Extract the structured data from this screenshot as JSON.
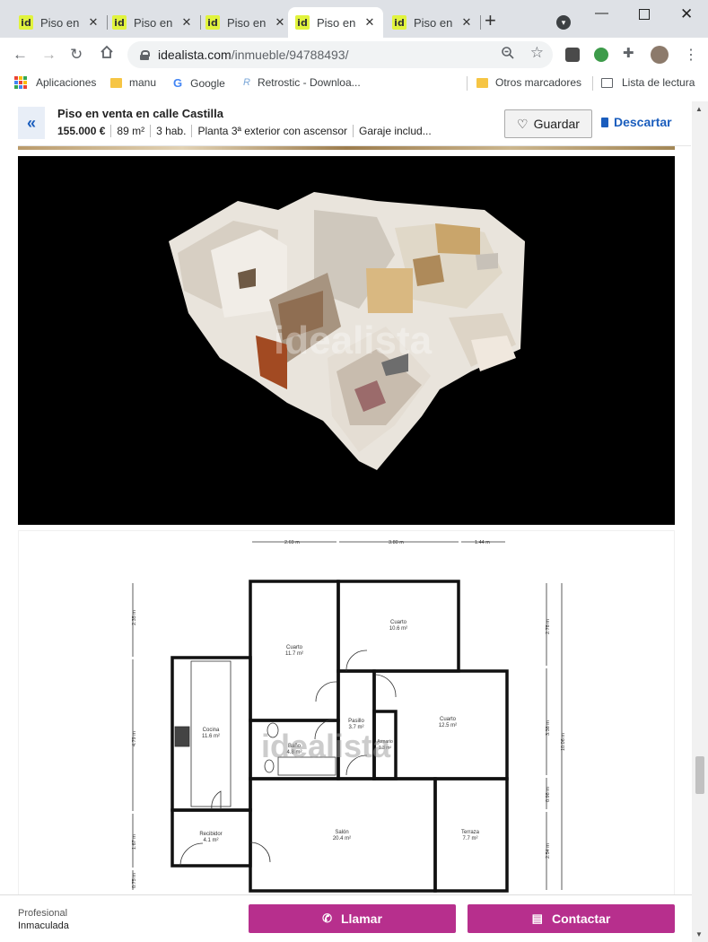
{
  "browser": {
    "tabs": [
      {
        "title": "Piso en",
        "favicon": "id",
        "active": false
      },
      {
        "title": "Piso en",
        "favicon": "id",
        "active": false
      },
      {
        "title": "Piso en",
        "favicon": "id",
        "active": false
      },
      {
        "title": "Piso en",
        "favicon": "id",
        "active": true
      },
      {
        "title": "Piso en",
        "favicon": "id",
        "active": false
      }
    ],
    "url_host": "idealista.com",
    "url_path": "/inmueble/94788493/",
    "bookmarks": [
      {
        "label": "Aplicaciones",
        "icon": "apps-icon"
      },
      {
        "label": "manu",
        "icon": "folder-icon"
      },
      {
        "label": "Google",
        "icon": "google-icon"
      },
      {
        "label": "Retrostic - Downloa...",
        "icon": "retrostic-icon"
      },
      {
        "label": "Otros marcadores",
        "icon": "folder-icon"
      },
      {
        "label": "Lista de lectura",
        "icon": "reading-list-icon"
      }
    ]
  },
  "listing": {
    "title": "Piso en venta en calle Castilla",
    "price": "155.000 €",
    "area": "89 m²",
    "rooms": "3 hab.",
    "floor": "Planta 3ª exterior con ascensor",
    "extra": "Garaje includ...",
    "save_label": "Guardar",
    "discard_label": "Descartar"
  },
  "media": {
    "watermark": "idealista",
    "floorplan": {
      "dims_top": [
        "2.69 m",
        "3.80 m",
        "1.44 m"
      ],
      "dims_left": [
        "2.35 m",
        "4.79 m",
        "1.67 m",
        "0.75 m"
      ],
      "dims_right_a": [
        "2.78 m",
        "3.38 m",
        "0.98 m",
        "2.54 m"
      ],
      "dims_right_b": "10.06 m",
      "rooms": [
        {
          "name": "Cuarto",
          "area": "11.7 m²"
        },
        {
          "name": "Cuarto",
          "area": "10.6 m²"
        },
        {
          "name": "Cocina",
          "area": "11.6 m²"
        },
        {
          "name": "Pasillo",
          "area": "3.7 m²"
        },
        {
          "name": "Cuarto",
          "area": "12.5 m²"
        },
        {
          "name": "Baño",
          "area": "4.8 m²"
        },
        {
          "name": "Armario",
          "area": "1.3 m²"
        },
        {
          "name": "Recibidor",
          "area": "4.1 m²"
        },
        {
          "name": "Salón",
          "area": "20.4 m²"
        },
        {
          "name": "Terraza",
          "area": "7.7 m²"
        }
      ]
    }
  },
  "contact_bar": {
    "agent_type": "Profesional",
    "agent_name": "Inmaculada",
    "call_label": "Llamar",
    "contact_label": "Contactar"
  },
  "colors": {
    "accent_blue": "#1a5dbd",
    "cta_magenta": "#b72f8d",
    "favicon_yellow": "#e1f33d"
  }
}
